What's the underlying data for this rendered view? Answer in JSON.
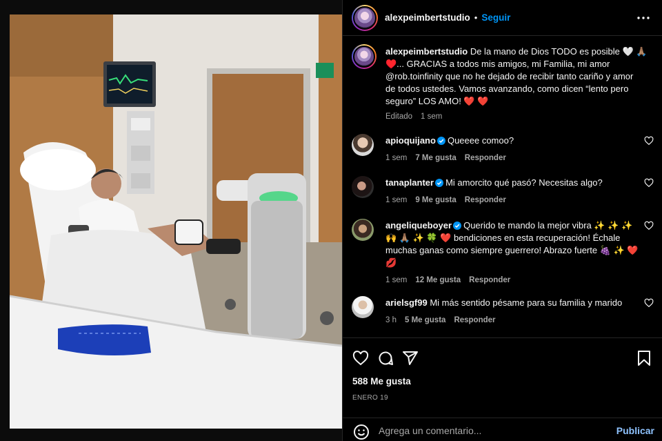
{
  "post": {
    "author": "alexpeimbertstudio",
    "follow_label": "Seguir",
    "separator": "•",
    "caption_lines": [
      "De la mano de Dios TODO es posible 🤍 🙏🏽",
      "♥️... GRACIAS a todos mis amigos, mi Familia, mi amor",
      "@rob.toinfinity que no he dejado de recibir tanto cariño y amor",
      "de todos ustedes. Vamos avanzando, como dicen “lento pero",
      "seguro” LOS AMO! ❤️ ❤️"
    ],
    "caption_meta": {
      "edited": "Editado",
      "time": "1 sem"
    },
    "likes": "588 Me gusta",
    "date": "ENERO 19"
  },
  "comments": [
    {
      "user": "apioquijano",
      "verified": true,
      "text": "Queeee comoo?",
      "time": "1 sem",
      "likes": "7 Me gusta",
      "reply": "Responder"
    },
    {
      "user": "tanaplanter",
      "verified": true,
      "text": "Mi amorcito qué pasó? Necesitas algo?",
      "time": "1 sem",
      "likes": "9 Me gusta",
      "reply": "Responder"
    },
    {
      "user": "angeliqueboyer",
      "verified": true,
      "text_lines": [
        "Querido te mando la mejor vibra ✨ ✨ ✨",
        "🙌 🙏🏽 ✨ 🍀 ❤️ bendiciones en esta recuperación! Échale",
        "muchas ganas como siempre guerrero! Abrazo fuerte 🍇 ✨ ❤️",
        "💋"
      ],
      "time": "1 sem",
      "likes": "12 Me gusta",
      "reply": "Responder"
    },
    {
      "user": "arielsgf99",
      "verified": false,
      "text": "Mi más sentido pésame para su familia y marido",
      "time": "3 h",
      "likes": "5 Me gusta",
      "reply": "Responder"
    }
  ],
  "add_comment": {
    "placeholder": "Agrega un comentario...",
    "publish": "Publicar"
  },
  "colors": {
    "accent": "#0095f6",
    "background": "#000000",
    "muted": "#a8a8a8",
    "heart": "#ff3040"
  }
}
